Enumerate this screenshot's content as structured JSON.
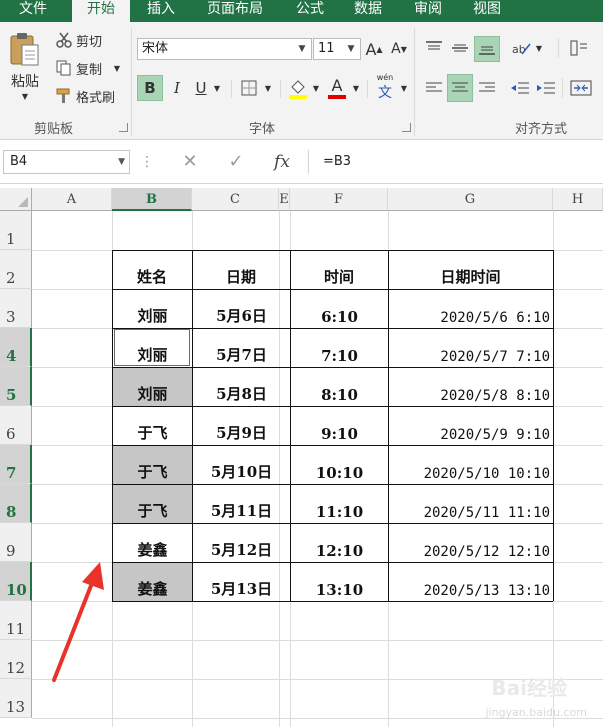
{
  "ribbon_tabs": [
    {
      "label": "文件"
    },
    {
      "label": "开始"
    },
    {
      "label": "插入"
    },
    {
      "label": "页面布局"
    },
    {
      "label": "公式"
    },
    {
      "label": "数据"
    },
    {
      "label": "审阅"
    },
    {
      "label": "视图"
    }
  ],
  "clipboard": {
    "paste_label": "粘贴",
    "cut_label": "剪切",
    "copy_label": "复制",
    "format_painter_label": "格式刷",
    "group_label": "剪贴板"
  },
  "font": {
    "font_name": "宋体",
    "font_size": "11",
    "grow_label": "A",
    "shrink_label": "A",
    "bold_label": "B",
    "italic_label": "I",
    "underline_label": "U",
    "font_color_label": "A",
    "phonetic_label": "文",
    "phonetic_top": "wén",
    "group_label": "字体"
  },
  "alignment": {
    "group_label": "对齐方式"
  },
  "formula_bar": {
    "name_box": "B4",
    "more_label": "⋮",
    "cancel_label": "✕",
    "enter_label": "✓",
    "function_label": "fx",
    "formula": "=B3"
  },
  "sheet": {
    "columns": [
      "A",
      "B",
      "C",
      "E",
      "F",
      "G",
      "H"
    ],
    "rows": [
      "1",
      "2",
      "3",
      "4",
      "5",
      "6",
      "7",
      "8",
      "9",
      "10",
      "11",
      "12",
      "13"
    ],
    "headers": [
      "姓名",
      "日期",
      "时间",
      "日期时间"
    ],
    "records": [
      {
        "name": "刘丽",
        "date": "5月6日",
        "time": "6:10",
        "datetime": "2020/5/6  6:10",
        "grey": false
      },
      {
        "name": "刘丽",
        "date": "5月7日",
        "time": "7:10",
        "datetime": "2020/5/7  7:10",
        "grey": false
      },
      {
        "name": "刘丽",
        "date": "5月8日",
        "time": "8:10",
        "datetime": "2020/5/8  8:10",
        "grey": true
      },
      {
        "name": "于飞",
        "date": "5月9日",
        "time": "9:10",
        "datetime": "2020/5/9  9:10",
        "grey": false
      },
      {
        "name": "于飞",
        "date": "5月10日",
        "time": "10:10",
        "datetime": "2020/5/10 10:10",
        "grey": true
      },
      {
        "name": "于飞",
        "date": "5月11日",
        "time": "11:10",
        "datetime": "2020/5/11 11:10",
        "grey": true
      },
      {
        "name": "姜鑫",
        "date": "5月12日",
        "time": "12:10",
        "datetime": "2020/5/12 12:10",
        "grey": false
      },
      {
        "name": "姜鑫",
        "date": "5月13日",
        "time": "13:10",
        "datetime": "2020/5/13 13:10",
        "grey": true
      }
    ]
  },
  "watermark": {
    "logo": "Bai经验",
    "url": "jingyan.baidu.com"
  },
  "colors": {
    "accent": "#217346",
    "arrow": "#e8322a",
    "selection_grey": "#c6c6c6"
  }
}
